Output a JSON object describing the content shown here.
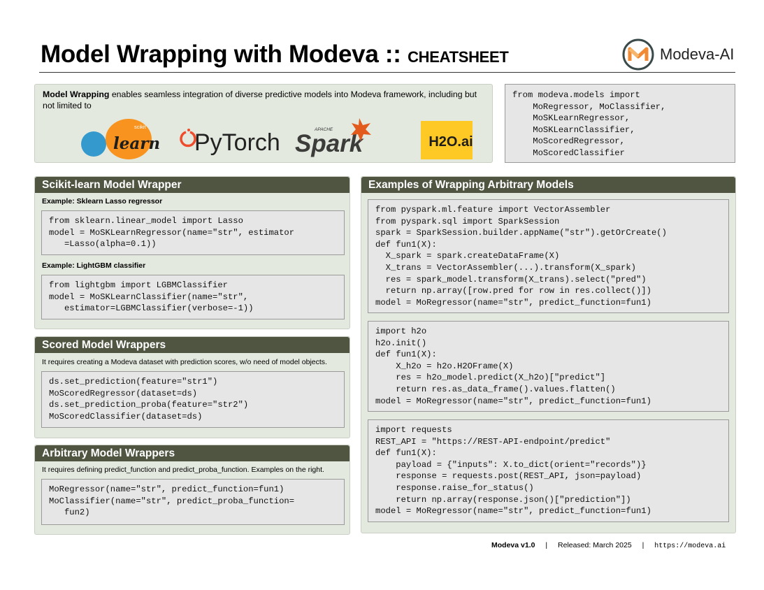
{
  "header": {
    "title": "Model Wrapping with Modeva ::",
    "subtitle": "CHEATSHEET",
    "brand": "Modeva-AI"
  },
  "intro": {
    "bold": "Model Wrapping",
    "text": " enables seamless integration of diverse predictive models into Modeva framework, including but not limited to",
    "logos": {
      "sklearn_small": "scikit",
      "sklearn": "learn",
      "pytorch": "PyTorch",
      "spark_small": "APACHE",
      "spark": "Spark",
      "h2o": "H2O.ai"
    }
  },
  "import_code": "from modeva.models import\n    MoRegressor, MoClassifier,\n    MoSKLearnRegressor,\n    MoSKLearnClassifier,\n    MoScoredRegressor,\n    MoScoredClassifier",
  "sklearn_panel": {
    "title": "Scikit-learn Model Wrapper",
    "ex1_label": "Example: Sklearn Lasso regressor",
    "ex1_code": "from sklearn.linear_model import Lasso\nmodel = MoSKLearnRegressor(name=\"str\", estimator\n   =Lasso(alpha=0.1))",
    "ex2_label": "Example: LightGBM classifier",
    "ex2_code": "from lightgbm import LGBMClassifier\nmodel = MoSKLearnClassifier(name=\"str\",\n   estimator=LGBMClassifier(verbose=-1))"
  },
  "scored_panel": {
    "title": "Scored Model Wrappers",
    "desc": "It requires creating a Modeva dataset with prediction scores, w/o need of model objects.",
    "code": "ds.set_prediction(feature=\"str1\")\nMoScoredRegressor(dataset=ds)\nds.set_prediction_proba(feature=\"str2\")\nMoScoredClassifier(dataset=ds)"
  },
  "arbitrary_panel": {
    "title": "Arbitrary Model Wrappers",
    "desc": "It requires defining predict_function and predict_proba_function. Examples on the right.",
    "code": "MoRegressor(name=\"str\", predict_function=fun1)\nMoClassifier(name=\"str\", predict_proba_function=\n   fun2)"
  },
  "examples_panel": {
    "title": "Examples of Wrapping Arbitrary Models",
    "code1": "from pyspark.ml.feature import VectorAssembler\nfrom pyspark.sql import SparkSession\nspark = SparkSession.builder.appName(\"str\").getOrCreate()\ndef fun1(X):\n  X_spark = spark.createDataFrame(X)\n  X_trans = VectorAssembler(...).transform(X_spark)\n  res = spark_model.transform(X_trans).select(\"pred\")\n  return np.array([row.pred for row in res.collect()])\nmodel = MoRegressor(name=\"str\", predict_function=fun1)",
    "code2": "import h2o\nh2o.init()\ndef fun1(X):\n    X_h2o = h2o.H2OFrame(X)\n    res = h2o_model.predict(X_h2o)[\"predict\"]\n    return res.as_data_frame().values.flatten()\nmodel = MoRegressor(name=\"str\", predict_function=fun1)",
    "code3": "import requests\nREST_API = \"https://REST-API-endpoint/predict\"\ndef fun1(X):\n    payload = {\"inputs\": X.to_dict(orient=\"records\")}\n    response = requests.post(REST_API, json=payload)\n    response.raise_for_status()\n    return np.array(response.json()[\"prediction\"])\nmodel = MoRegressor(name=\"str\", predict_function=fun1)"
  },
  "footer": {
    "version": "Modeva v1.0",
    "sep": "|",
    "released": "Released: March 2025",
    "url": "https://modeva.ai"
  },
  "colors": {
    "panel_header": "#4f5541",
    "panel_bg": "#e3e9df",
    "code_bg": "#e6e6e6",
    "sklearn_orange": "#f7931e",
    "sklearn_blue": "#3499cd",
    "pytorch_orange": "#ee4c2c",
    "h2o_yellow": "#fec925"
  }
}
